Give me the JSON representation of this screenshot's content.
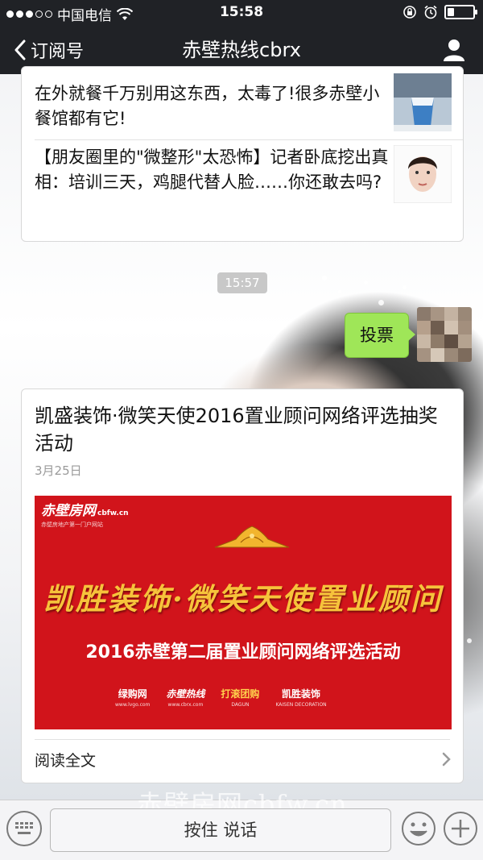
{
  "status_bar": {
    "carrier": "中国电信",
    "time": "15:58"
  },
  "nav": {
    "back_label": "订阅号",
    "title": "赤壁热线cbrx"
  },
  "article_list": [
    {
      "title": "在外就餐千万别用这东西，太毒了!很多赤壁小餐馆都有它!",
      "thumb_icon": "cup-photo-thumb"
    },
    {
      "title": "【朋友圈里的\"微整形\"太恐怖】记者卧底挖出真相：培训三天，鸡腿代替人脸……你还敢去吗?",
      "thumb_icon": "face-photo-thumb"
    }
  ],
  "chat": {
    "time_label": "15:57",
    "my_message": "投票"
  },
  "article_card": {
    "title": "凯盛装饰·微笑天使2016置业顾问网络评选抽奖活动",
    "date": "3月25日",
    "banner": {
      "logo": "赤壁房网",
      "logo_suffix": "cbfw.cn",
      "logo_tagline": "赤壁房地产第一门户网站",
      "headline": "凯胜装饰·微笑天使置业顾问",
      "subtitle": "2016赤壁第二届置业顾问网络评选活动",
      "sponsors": [
        {
          "name": "绿购网",
          "url": "www.lvgo.com"
        },
        {
          "name": "赤壁热线",
          "url": "www.cbrx.com"
        },
        {
          "name": "打滚团购",
          "url": "DAGUN"
        },
        {
          "name": "凯胜装饰",
          "url": "KAISEN DECORATION"
        }
      ]
    },
    "read_more": "阅读全文"
  },
  "input_bar": {
    "hold_to_talk": "按住 说话",
    "watermark": "赤壁房网cbfw.cn"
  },
  "colors": {
    "bar_dark": "#202226",
    "bubble_green": "#9fe658",
    "banner_red": "#d1141b",
    "banner_gold": "#f6c33b"
  }
}
